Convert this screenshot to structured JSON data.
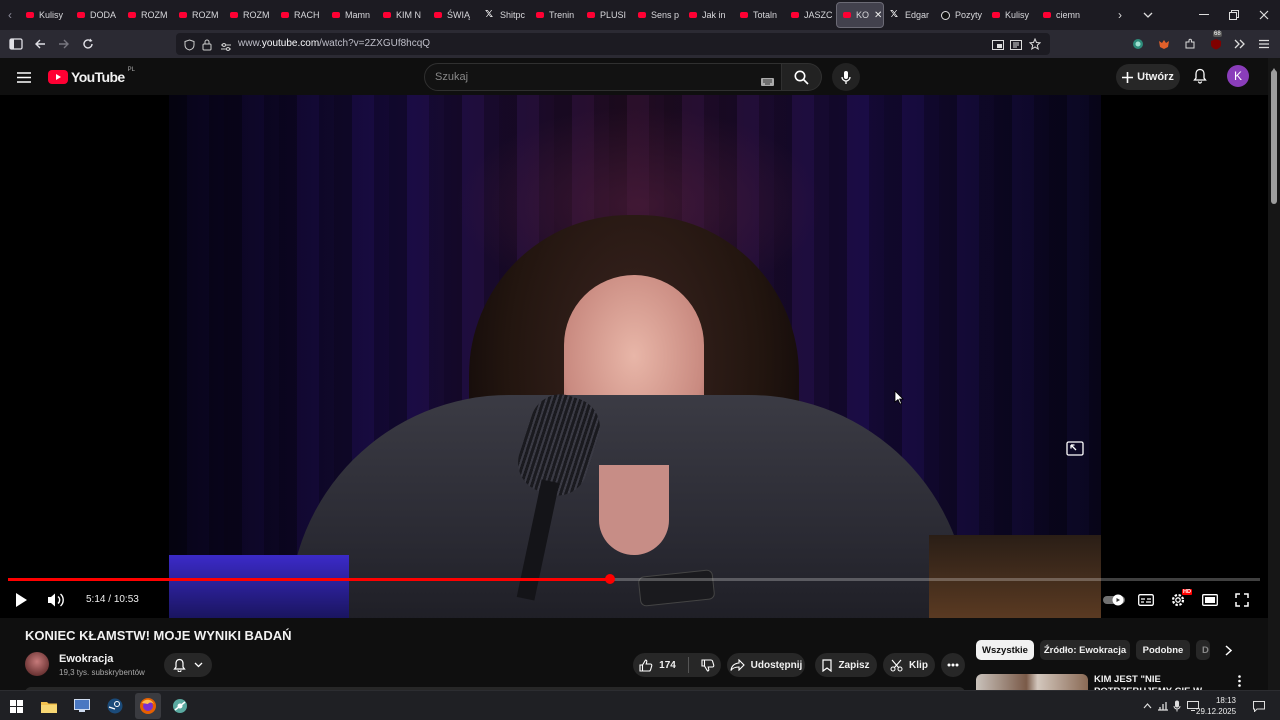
{
  "browser": {
    "tabs": [
      {
        "label": "Kulisy",
        "icon": "youtube-icon"
      },
      {
        "label": "DODA",
        "icon": "youtube-icon"
      },
      {
        "label": "ROZM",
        "icon": "youtube-icon"
      },
      {
        "label": "ROZM",
        "icon": "youtube-icon"
      },
      {
        "label": "ROZM",
        "icon": "youtube-icon"
      },
      {
        "label": "RACH",
        "icon": "youtube-icon"
      },
      {
        "label": "Mamn",
        "icon": "youtube-icon"
      },
      {
        "label": "KIM N",
        "icon": "youtube-icon"
      },
      {
        "label": "ŚWIĄ",
        "icon": "youtube-icon"
      },
      {
        "label": "Shitpc",
        "icon": "x-icon"
      },
      {
        "label": "Trenin",
        "icon": "youtube-icon"
      },
      {
        "label": "PLUSI",
        "icon": "youtube-icon"
      },
      {
        "label": "Sens p",
        "icon": "youtube-icon"
      },
      {
        "label": "Jak in",
        "icon": "youtube-icon"
      },
      {
        "label": "Totaln",
        "icon": "youtube-icon"
      },
      {
        "label": "JASZC",
        "icon": "youtube-icon"
      },
      {
        "label": "KO",
        "icon": "youtube-icon",
        "active": true
      },
      {
        "label": "Edgar",
        "icon": "x-icon"
      },
      {
        "label": "Pozyty",
        "icon": "tiktok-icon"
      },
      {
        "label": "Kulisy",
        "icon": "youtube-icon"
      },
      {
        "label": "ciemn",
        "icon": "youtube-icon"
      }
    ],
    "url_prefix": "www.",
    "url_domain": "youtube.com",
    "url_path": "/watch?v=2ZXGUf8hcqQ",
    "extension_badge": "68"
  },
  "youtube": {
    "logo_text": "YouTube",
    "region": "PL",
    "search_placeholder": "Szukaj",
    "create_label": "Utwórz",
    "avatar_letter": "K"
  },
  "player": {
    "current_time": "5:14",
    "duration": "10:53",
    "progress_fraction": 0.481,
    "settings_badge": "HD"
  },
  "video": {
    "title": "KONIEC KŁAMSTW! MOJE WYNIKI BADAŃ",
    "channel_name": "Ewokracja",
    "subscribers": "19,3 tys. subskrybentów",
    "like_count": "174",
    "share_label": "Udostępnij",
    "save_label": "Zapisz",
    "clip_label": "Klip"
  },
  "chips": [
    "Wszystkie",
    "Źródło: Ewokracja",
    "Podobne",
    "D"
  ],
  "recommended": {
    "title": "KIM JEST \"NIE POTRZEBUJEMY CIĘ W NASZYM SKŁADZIE\""
  },
  "taskbar": {
    "time": "18:13",
    "date": "29.12.2025"
  },
  "colors": {
    "youtube_red": "#ff0033",
    "progress": "#ff0000",
    "background": "#0f0f0f",
    "avatar": "#8a3dba"
  }
}
